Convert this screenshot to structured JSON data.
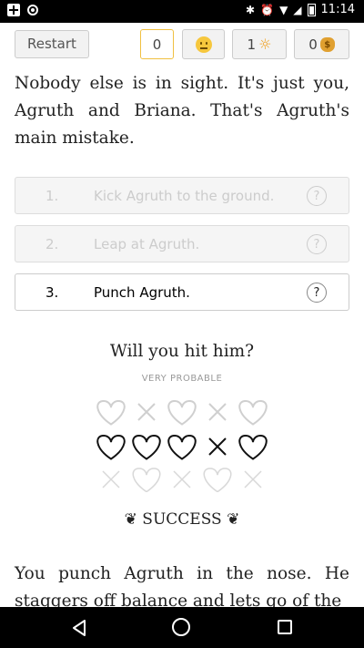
{
  "status_bar": {
    "time": "11:14"
  },
  "toolbar": {
    "restart_label": "Restart",
    "stat1": "0",
    "stat2_icon": "neutral-face-icon",
    "stat3_value": "1",
    "stat3_icon": "sun-icon",
    "stat4_value": "0",
    "stat4_icon": "money-bag-icon"
  },
  "story": {
    "para1": "Nobody else is in sight. It's just you, Agruth and Briana. That's Agruth's main mistake.",
    "para2": "You punch Agruth in the nose. He staggers off balance and lets go of the"
  },
  "choices": [
    {
      "num": "1.",
      "text": "Kick Agruth to the ground.",
      "help": "?",
      "enabled": false
    },
    {
      "num": "2.",
      "text": "Leap at Agruth.",
      "help": "?",
      "enabled": false
    },
    {
      "num": "3.",
      "text": "Punch Agruth.",
      "help": "?",
      "enabled": true
    }
  ],
  "roll": {
    "question": "Will you hit him?",
    "probability": "VERY PROBABLE",
    "result": "❦ SUCCESS ❦",
    "rows": [
      [
        "heart",
        "cross",
        "heart",
        "cross",
        "heart"
      ],
      [
        "heart",
        "heart",
        "heart",
        "cross",
        "heart"
      ],
      [
        "cross",
        "heart",
        "cross",
        "heart",
        "cross"
      ]
    ]
  },
  "colors": {
    "accent_border": "#f0c040",
    "muted_text": "#cccccc"
  }
}
